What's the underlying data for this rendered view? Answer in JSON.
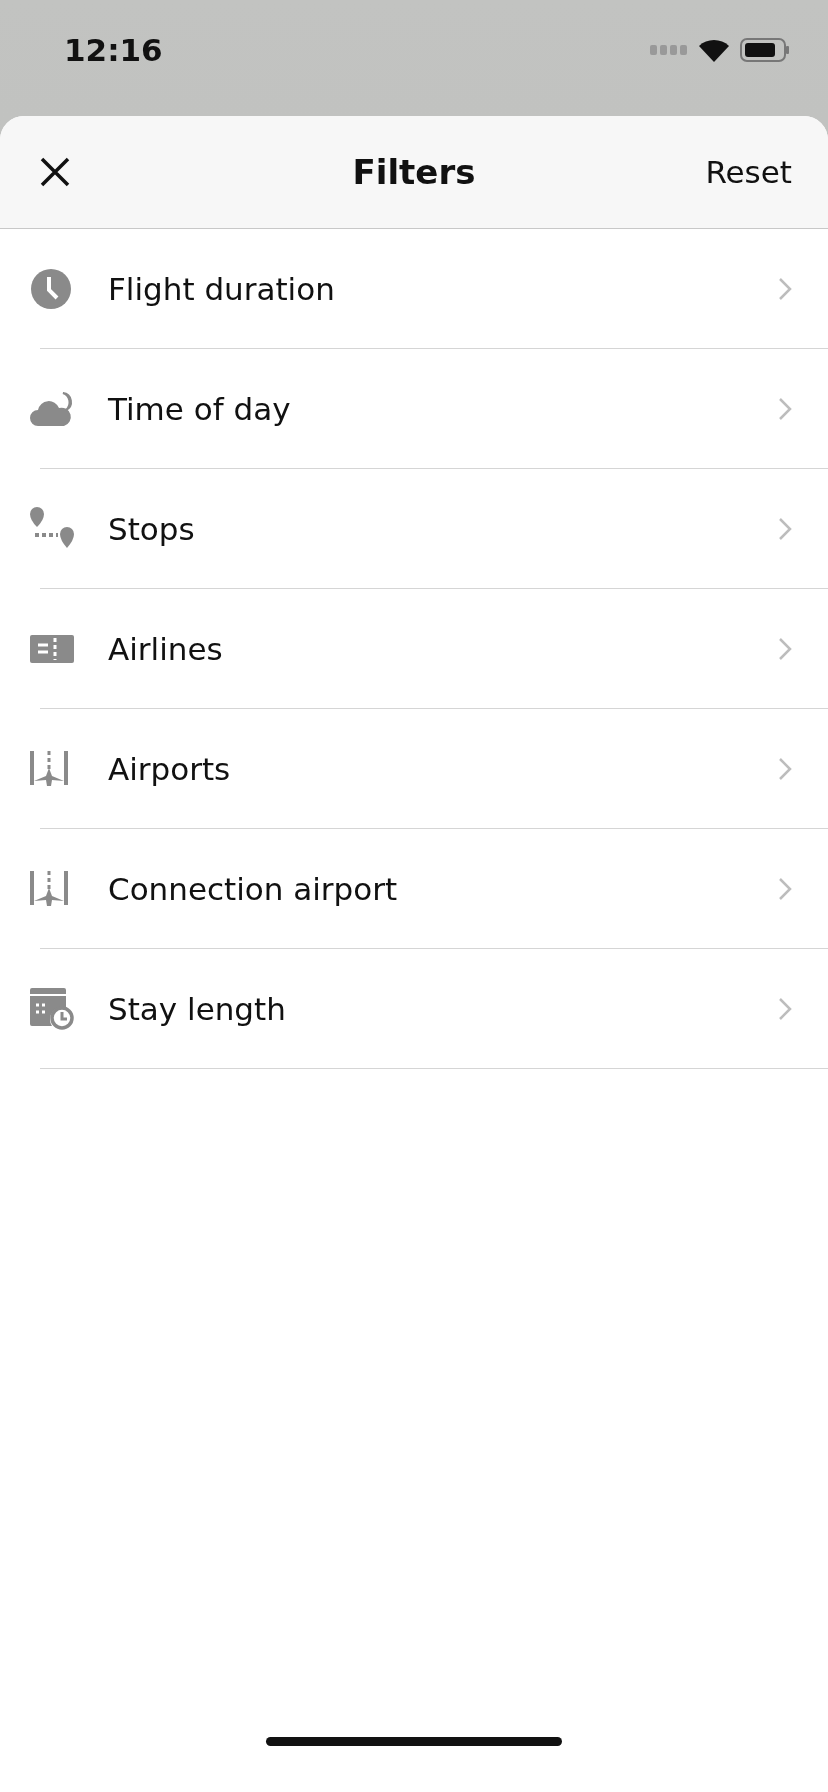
{
  "status_bar": {
    "time": "12:16"
  },
  "header": {
    "title": "Filters",
    "reset": "Reset"
  },
  "filters": [
    {
      "kind": "clock",
      "label": "Flight duration"
    },
    {
      "kind": "night",
      "label": "Time of day"
    },
    {
      "kind": "stops",
      "label": "Stops"
    },
    {
      "kind": "ticket",
      "label": "Airlines"
    },
    {
      "kind": "runway",
      "label": "Airports"
    },
    {
      "kind": "runway",
      "label": "Connection airport"
    },
    {
      "kind": "calendar",
      "label": "Stay length"
    }
  ]
}
